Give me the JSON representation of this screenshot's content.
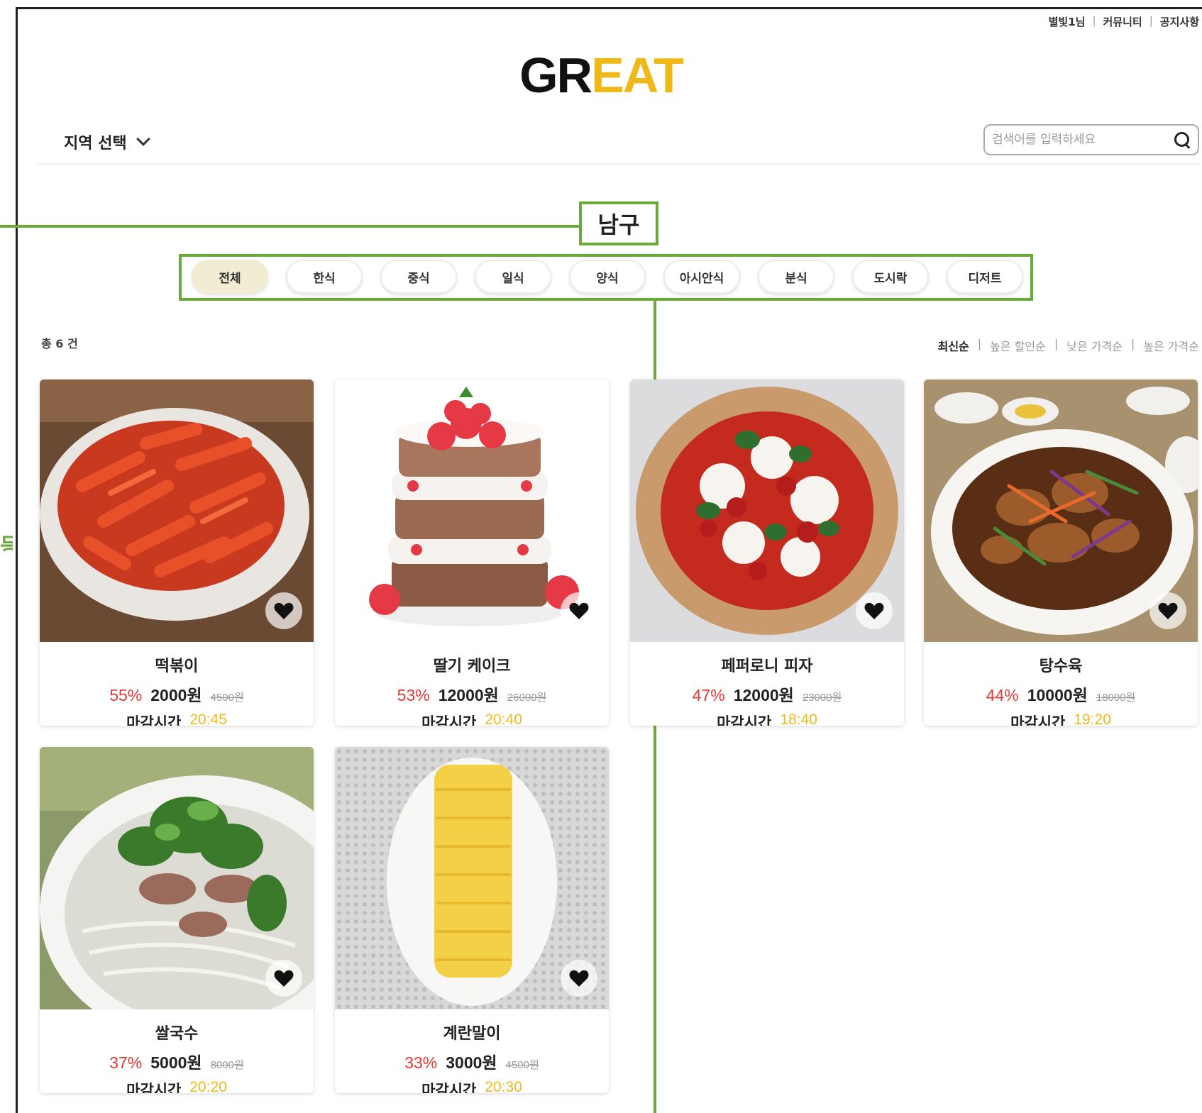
{
  "top_links": [
    "별빛1님",
    "커뮤니티",
    "공지사항"
  ],
  "top_link_separator": "|",
  "logo": {
    "part1": "GR",
    "part2": "EAT",
    "accent": "#f0b91a"
  },
  "region_select": {
    "label": "지역 선택",
    "icon": "chevron-down-icon"
  },
  "search": {
    "placeholder": "검색어를 입력하세요",
    "icon": "search-icon"
  },
  "district": "남구",
  "side_glyph": "등",
  "categories": [
    {
      "label": "전체",
      "active": true
    },
    {
      "label": "한식",
      "active": false
    },
    {
      "label": "중식",
      "active": false
    },
    {
      "label": "일식",
      "active": false
    },
    {
      "label": "양식",
      "active": false
    },
    {
      "label": "아시안식",
      "active": false
    },
    {
      "label": "분식",
      "active": false
    },
    {
      "label": "도시락",
      "active": false
    },
    {
      "label": "디저트",
      "active": false
    }
  ],
  "total_count": "총 6 건",
  "sort_options": [
    {
      "label": "최신순",
      "active": true
    },
    {
      "label": "높은 할인순",
      "active": false
    },
    {
      "label": "낮은 가격순",
      "active": false
    },
    {
      "label": "높은 가격순",
      "active": false
    }
  ],
  "sort_separator": "|",
  "deadline_label": "마감시간",
  "heart_icon": "heart-icon",
  "colors": {
    "accent": "#f0b91a",
    "discount": "#e53935",
    "annotation": "#6aaa3a",
    "active_tab": "#f2ecd3"
  },
  "products": [
    {
      "name": "떡볶이",
      "discount": "55%",
      "price": "2000원",
      "original": "4500원",
      "deadline": "20:45",
      "image": "tteokbokki"
    },
    {
      "name": "딸기 케이크",
      "discount": "53%",
      "price": "12000원",
      "original": "26000원",
      "deadline": "20:40",
      "image": "strawberry-cake"
    },
    {
      "name": "페퍼로니 피자",
      "discount": "47%",
      "price": "12000원",
      "original": "23000원",
      "deadline": "18:40",
      "image": "pizza"
    },
    {
      "name": "탕수육",
      "discount": "44%",
      "price": "10000원",
      "original": "18000원",
      "deadline": "19:20",
      "image": "tangsuyuk"
    },
    {
      "name": "쌀국수",
      "discount": "37%",
      "price": "5000원",
      "original": "8000원",
      "deadline": "20:20",
      "image": "pho"
    },
    {
      "name": "계란말이",
      "discount": "33%",
      "price": "3000원",
      "original": "4500원",
      "deadline": "20:30",
      "image": "egg-roll"
    }
  ]
}
